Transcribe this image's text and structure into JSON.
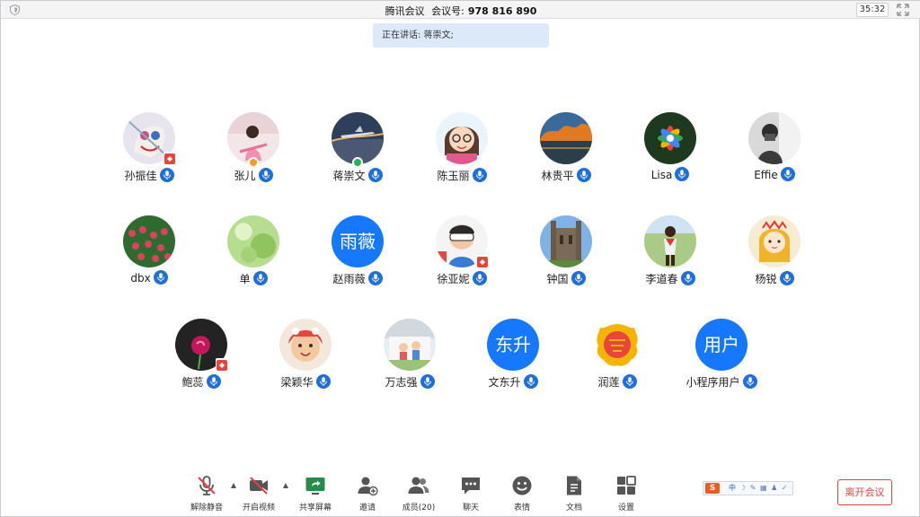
{
  "titlebar": {
    "app_name": "腾讯会议",
    "meeting_label": "会议号:",
    "meeting_number": "978 816 890",
    "timer": "35:32"
  },
  "speaking": {
    "text": "正在讲话: 蒋崇文;"
  },
  "participants": [
    {
      "name": "孙振佳",
      "avatar": "photo"
    },
    {
      "name": "张儿",
      "avatar": "photo"
    },
    {
      "name": "蒋崇文",
      "avatar": "photo"
    },
    {
      "name": "陈玉丽",
      "avatar": "photo"
    },
    {
      "name": "林贵平",
      "avatar": "photo"
    },
    {
      "name": "Lisa",
      "avatar": "photo"
    },
    {
      "name": "Effie",
      "avatar": "photo"
    },
    {
      "name": "dbx",
      "avatar": "photo"
    },
    {
      "name": "单",
      "avatar": "photo"
    },
    {
      "name": "赵雨薇",
      "avatar": "text",
      "avatar_text": "雨薇"
    },
    {
      "name": "徐亚妮",
      "avatar": "photo"
    },
    {
      "name": "钟国",
      "avatar": "photo"
    },
    {
      "name": "李道春",
      "avatar": "photo"
    },
    {
      "name": "杨锐",
      "avatar": "photo"
    },
    {
      "name": "鲍蕊",
      "avatar": "photo"
    },
    {
      "name": "梁颖华",
      "avatar": "photo"
    },
    {
      "name": "万志强",
      "avatar": "photo"
    },
    {
      "name": "文东升",
      "avatar": "text",
      "avatar_text": "东升"
    },
    {
      "name": "润莲",
      "avatar": "photo"
    },
    {
      "name": "小程序用户",
      "avatar": "text",
      "avatar_text": "用户"
    }
  ],
  "toolbar": {
    "unmute": "解除静音",
    "start_video": "开启视频",
    "share_screen": "共享屏幕",
    "invite": "邀请",
    "members": "成员(20)",
    "chat": "聊天",
    "reactions": "表情",
    "docs": "文档",
    "settings": "设置",
    "leave": "离开会议"
  },
  "ime": {
    "logo": "S",
    "mode": "中"
  },
  "colors": {
    "accent": "#1677ff",
    "leave": "#e04343",
    "mic_badge": "#1e6fd9",
    "speaking_bg": "#dbe9fb"
  }
}
